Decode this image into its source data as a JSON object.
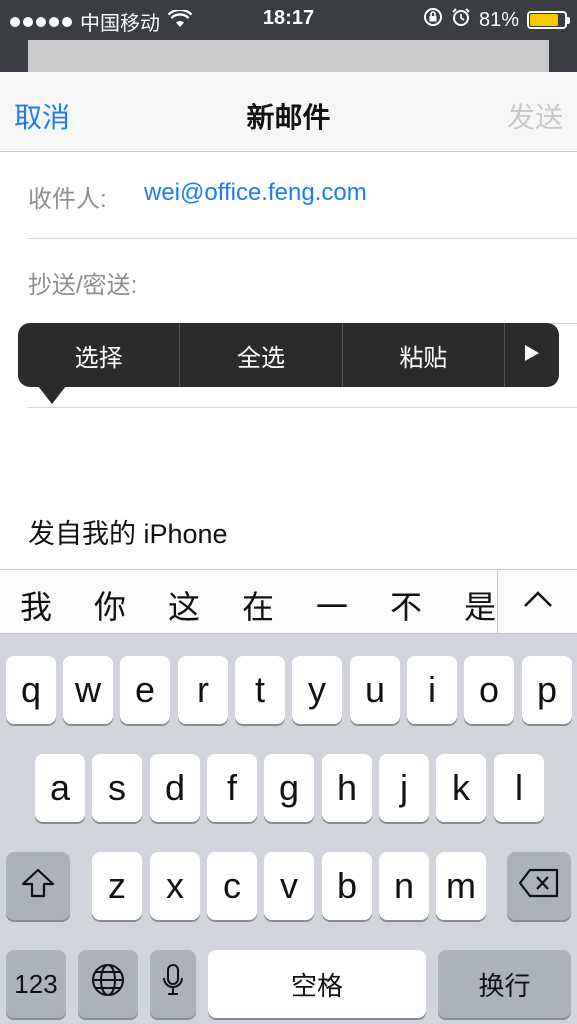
{
  "status_bar": {
    "carrier": "中国移动",
    "time": "18:17",
    "battery_percent": "81%",
    "battery_level": 0.81,
    "icons": [
      "signal-icon",
      "wifi-icon",
      "orientation-lock-icon",
      "alarm-icon",
      "battery-icon"
    ]
  },
  "nav": {
    "cancel": "取消",
    "title": "新邮件",
    "send": "发送"
  },
  "fields": {
    "to_label": "收件人:",
    "to_value": "wei@office.feng.com",
    "cc_label": "抄送/密送:"
  },
  "popup": {
    "select": "选择",
    "select_all": "全选",
    "paste": "粘贴",
    "more_icon": "triangle-right-icon"
  },
  "body": {
    "signature": "发自我的 iPhone"
  },
  "candidates": [
    "我",
    "你",
    "这",
    "在",
    "一",
    "不",
    "是"
  ],
  "keyboard": {
    "row1": [
      "q",
      "w",
      "e",
      "r",
      "t",
      "y",
      "u",
      "i",
      "o",
      "p"
    ],
    "row2": [
      "a",
      "s",
      "d",
      "f",
      "g",
      "h",
      "j",
      "k",
      "l"
    ],
    "row3": [
      "z",
      "x",
      "c",
      "v",
      "b",
      "n",
      "m"
    ],
    "numbers": "123",
    "space": "空格",
    "return": "换行"
  },
  "colors": {
    "accent": "#1a7cf4",
    "disabled": "#c7c7cc",
    "battery": "#f5c800"
  }
}
